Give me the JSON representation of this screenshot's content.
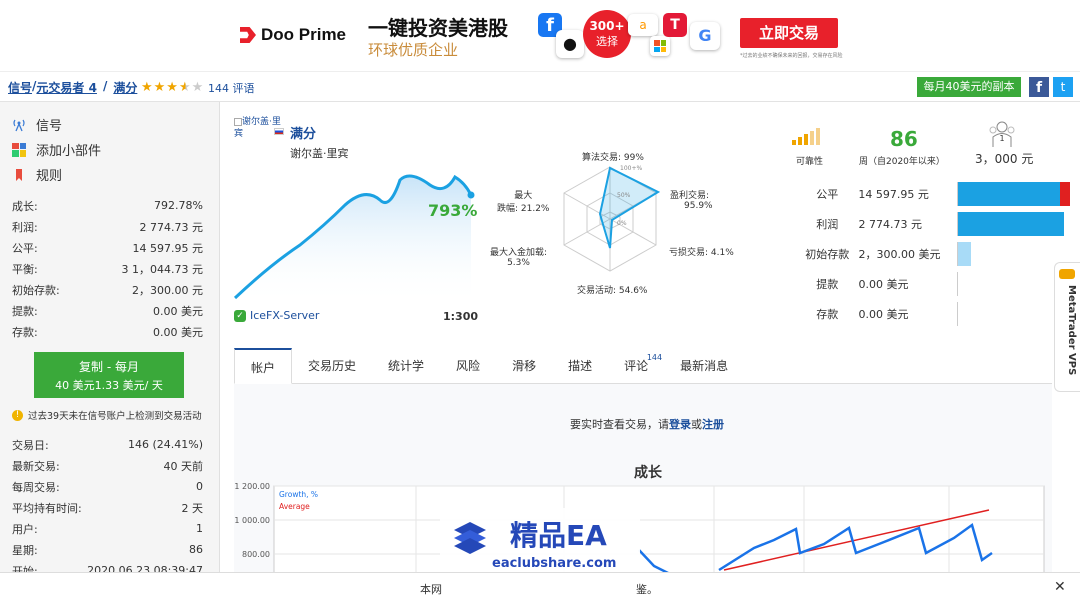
{
  "banner": {
    "brand": "Doo Prime",
    "slogan_main": "一键投资美港股",
    "slogan_sub": "环球优质企业",
    "badge_top": "300+",
    "badge_bottom": "选择",
    "cta": "立即交易",
    "disclaimer": "*过去的业绩不确保未来的回报，交易存在风险",
    "icons": [
      "facebook-icon",
      "apple-icon",
      "amazon-icon",
      "microsoft-icon",
      "tesla-icon",
      "google-icon"
    ]
  },
  "breadcrumb": {
    "part1": "信号",
    "sep": "/",
    "part2": "元交易者 4",
    "part3": "满分",
    "rating_reviews": "144 评语",
    "rating": 3.5
  },
  "topbar": {
    "copy_button": "每月40美元的副本"
  },
  "sidebar": {
    "nav": [
      {
        "label": "信号",
        "icon": "signal-icon"
      },
      {
        "label": "添加小部件",
        "icon": "widget-icon"
      },
      {
        "label": "规则",
        "icon": "bookmark-icon"
      }
    ],
    "stats": [
      {
        "k": "成长:",
        "v": "792.78%"
      },
      {
        "k": "利润:",
        "v": "2 774.73 元"
      },
      {
        "k": "公平:",
        "v": "14 597.95 元"
      },
      {
        "k": "平衡:",
        "v": "3 1，044.73 元"
      },
      {
        "k": "初始存款:",
        "v": "2，300.00 元"
      },
      {
        "k": "提款:",
        "v": "0.00 美元"
      },
      {
        "k": "存款:",
        "v": "0.00 美元"
      }
    ],
    "subscribe_line1": "复制 - 每月",
    "subscribe_line2": "40 美元1.33 美元/ 天",
    "warning": "过去39天未在信号账户上检测到交易活动",
    "stats2": [
      {
        "k": "交易日:",
        "v": "146 (24.41%)"
      },
      {
        "k": "最新交易:",
        "v": "40 天前"
      },
      {
        "k": "每周交易:",
        "v": "0"
      },
      {
        "k": "平均持有时间:",
        "v": "2 天"
      },
      {
        "k": "用户:",
        "v": "1"
      },
      {
        "k": "星期:",
        "v": "86"
      },
      {
        "k": "开始:",
        "v": "2020.06.23 08:39:47"
      }
    ]
  },
  "signal": {
    "avatar_alt": "谢尔盖·里宾",
    "name": "满分",
    "author": "谢尔盖·里宾",
    "growth_pct": "793%",
    "server": "IceFX-Server",
    "leverage": "1:300"
  },
  "radar": {
    "algo": "算法交易:  99%",
    "profit_label": "盈利交易:",
    "profit": "95.9%",
    "loss": "亏损交易:  4.1%",
    "activity": "交易活动:  54.6%",
    "deposit_load_label": "最大入金加载:",
    "deposit_load": "5.3%",
    "drawdown_label1": "最大",
    "drawdown_label2": "跌幅:  21.2%",
    "ring100": "100+%",
    "ring50": "50%",
    "ring0": "0%"
  },
  "reliability": {
    "label": "可靠性",
    "weeks": "86",
    "weeks_label": "周（自2020年以来）",
    "subscribers": "3，000 元",
    "subscriber_count": "1"
  },
  "bars": [
    {
      "label": "公平",
      "value": "14 597.95 元",
      "fill": 0.97,
      "red": 0.09
    },
    {
      "label": "利润",
      "value": "2 774.73 元",
      "fill": 0.91,
      "red": 0
    },
    {
      "label": "初始存款",
      "value": "2，300.00 美元",
      "fill": 0.11,
      "red": 0
    },
    {
      "label": "提款",
      "value": "0.00 美元",
      "fill": 0,
      "red": 0
    },
    {
      "label": "存款",
      "value": "0.00 美元",
      "fill": 0,
      "red": 0
    }
  ],
  "tabs": [
    "帐户",
    "交易历史",
    "统计学",
    "风险",
    "滑移",
    "描述",
    "评论",
    "最新消息"
  ],
  "tabs_review_count": "144",
  "account_msg": {
    "before": "要实时查看交易，请",
    "login": "登录",
    "or": "或",
    "register": "注册"
  },
  "vps_label": "MetaTrader VPS",
  "growth_chart": {
    "title": "成长",
    "legend_growth": "Growth, %",
    "legend_avg": "Average",
    "y_ticks": [
      "1 200.00",
      "1 000.00",
      "800.00"
    ],
    "colors": {
      "growth": "#1a73e8",
      "average": "#e02020"
    }
  },
  "watermark": {
    "title": "精品EA",
    "url": "eaclubshare.com"
  },
  "cookie": {
    "left": "本网",
    "right": "鉴。",
    "close": "✕"
  }
}
